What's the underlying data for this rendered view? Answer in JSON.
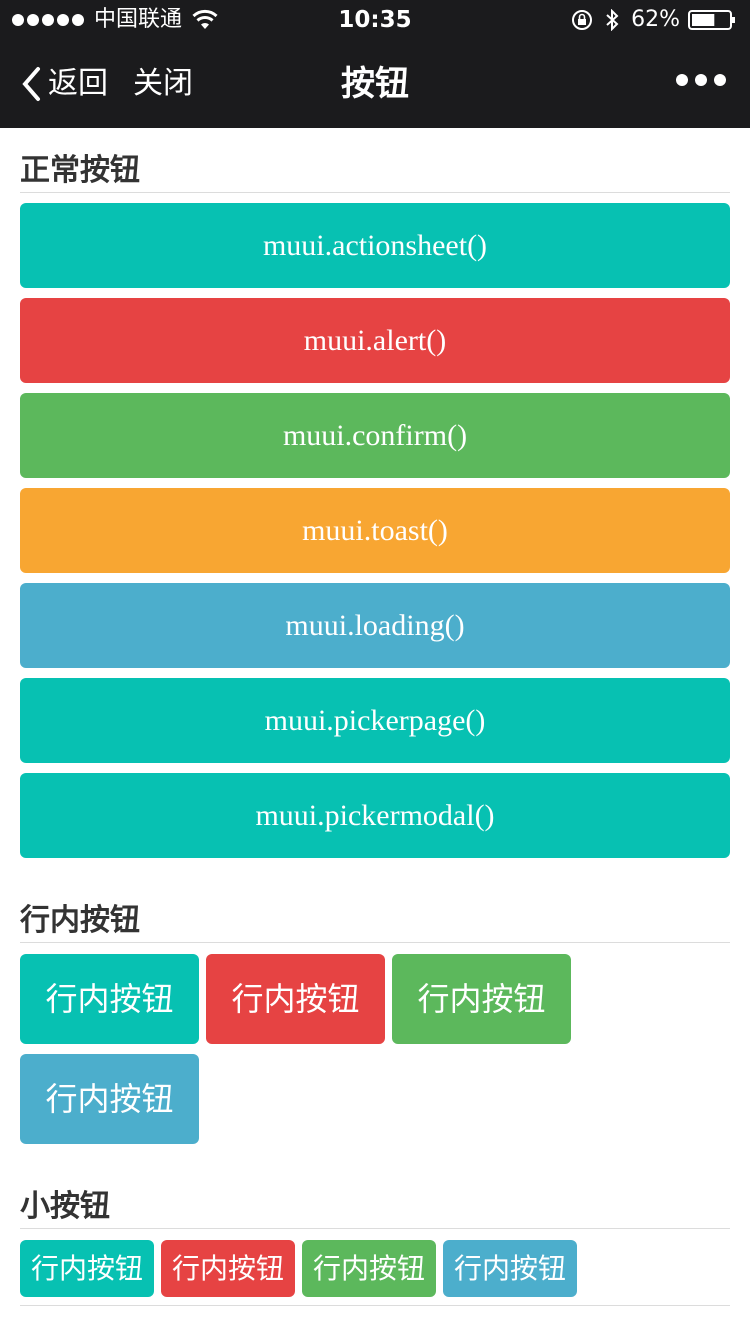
{
  "status_bar": {
    "carrier": "中国联通",
    "time": "10:35",
    "battery": "62%",
    "battery_level": 0.62
  },
  "nav": {
    "back_label": "返回",
    "close_label": "关闭",
    "title": "按钮"
  },
  "colors": {
    "teal": "#07c1b2",
    "red": "#e64343",
    "green": "#5cb85c",
    "orange": "#f8a632",
    "blue": "#4caecc",
    "nav_bg": "#1b1b1d"
  },
  "sections": {
    "normal": {
      "title": "正常按钮",
      "buttons": [
        {
          "label": "muui.actionsheet()",
          "color": "#07c1b2"
        },
        {
          "label": "muui.alert()",
          "color": "#e64343"
        },
        {
          "label": "muui.confirm()",
          "color": "#5cb85c"
        },
        {
          "label": "muui.toast()",
          "color": "#f8a632"
        },
        {
          "label": "muui.loading()",
          "color": "#4caecc"
        },
        {
          "label": "muui.pickerpage()",
          "color": "#07c1b2"
        },
        {
          "label": "muui.pickermodal()",
          "color": "#07c1b2"
        }
      ]
    },
    "inline": {
      "title": "行内按钮",
      "buttons": [
        {
          "label": "行内按钮",
          "color": "#07c1b2"
        },
        {
          "label": "行内按钮",
          "color": "#e64343"
        },
        {
          "label": "行内按钮",
          "color": "#5cb85c"
        },
        {
          "label": "行内按钮",
          "color": "#4caecc"
        }
      ]
    },
    "small": {
      "title": "小按钮",
      "buttons": [
        {
          "label": "行内按钮",
          "color": "#07c1b2"
        },
        {
          "label": "行内按钮",
          "color": "#e64343"
        },
        {
          "label": "行内按钮",
          "color": "#5cb85c"
        },
        {
          "label": "行内按钮",
          "color": "#4caecc"
        }
      ]
    }
  },
  "icons": {
    "signal": "signal-dots-icon",
    "wifi": "wifi-icon",
    "lock": "orientation-lock-icon",
    "bluetooth": "bluetooth-icon",
    "battery": "battery-icon",
    "back": "chevron-left-icon",
    "more": "more-dots-icon"
  }
}
